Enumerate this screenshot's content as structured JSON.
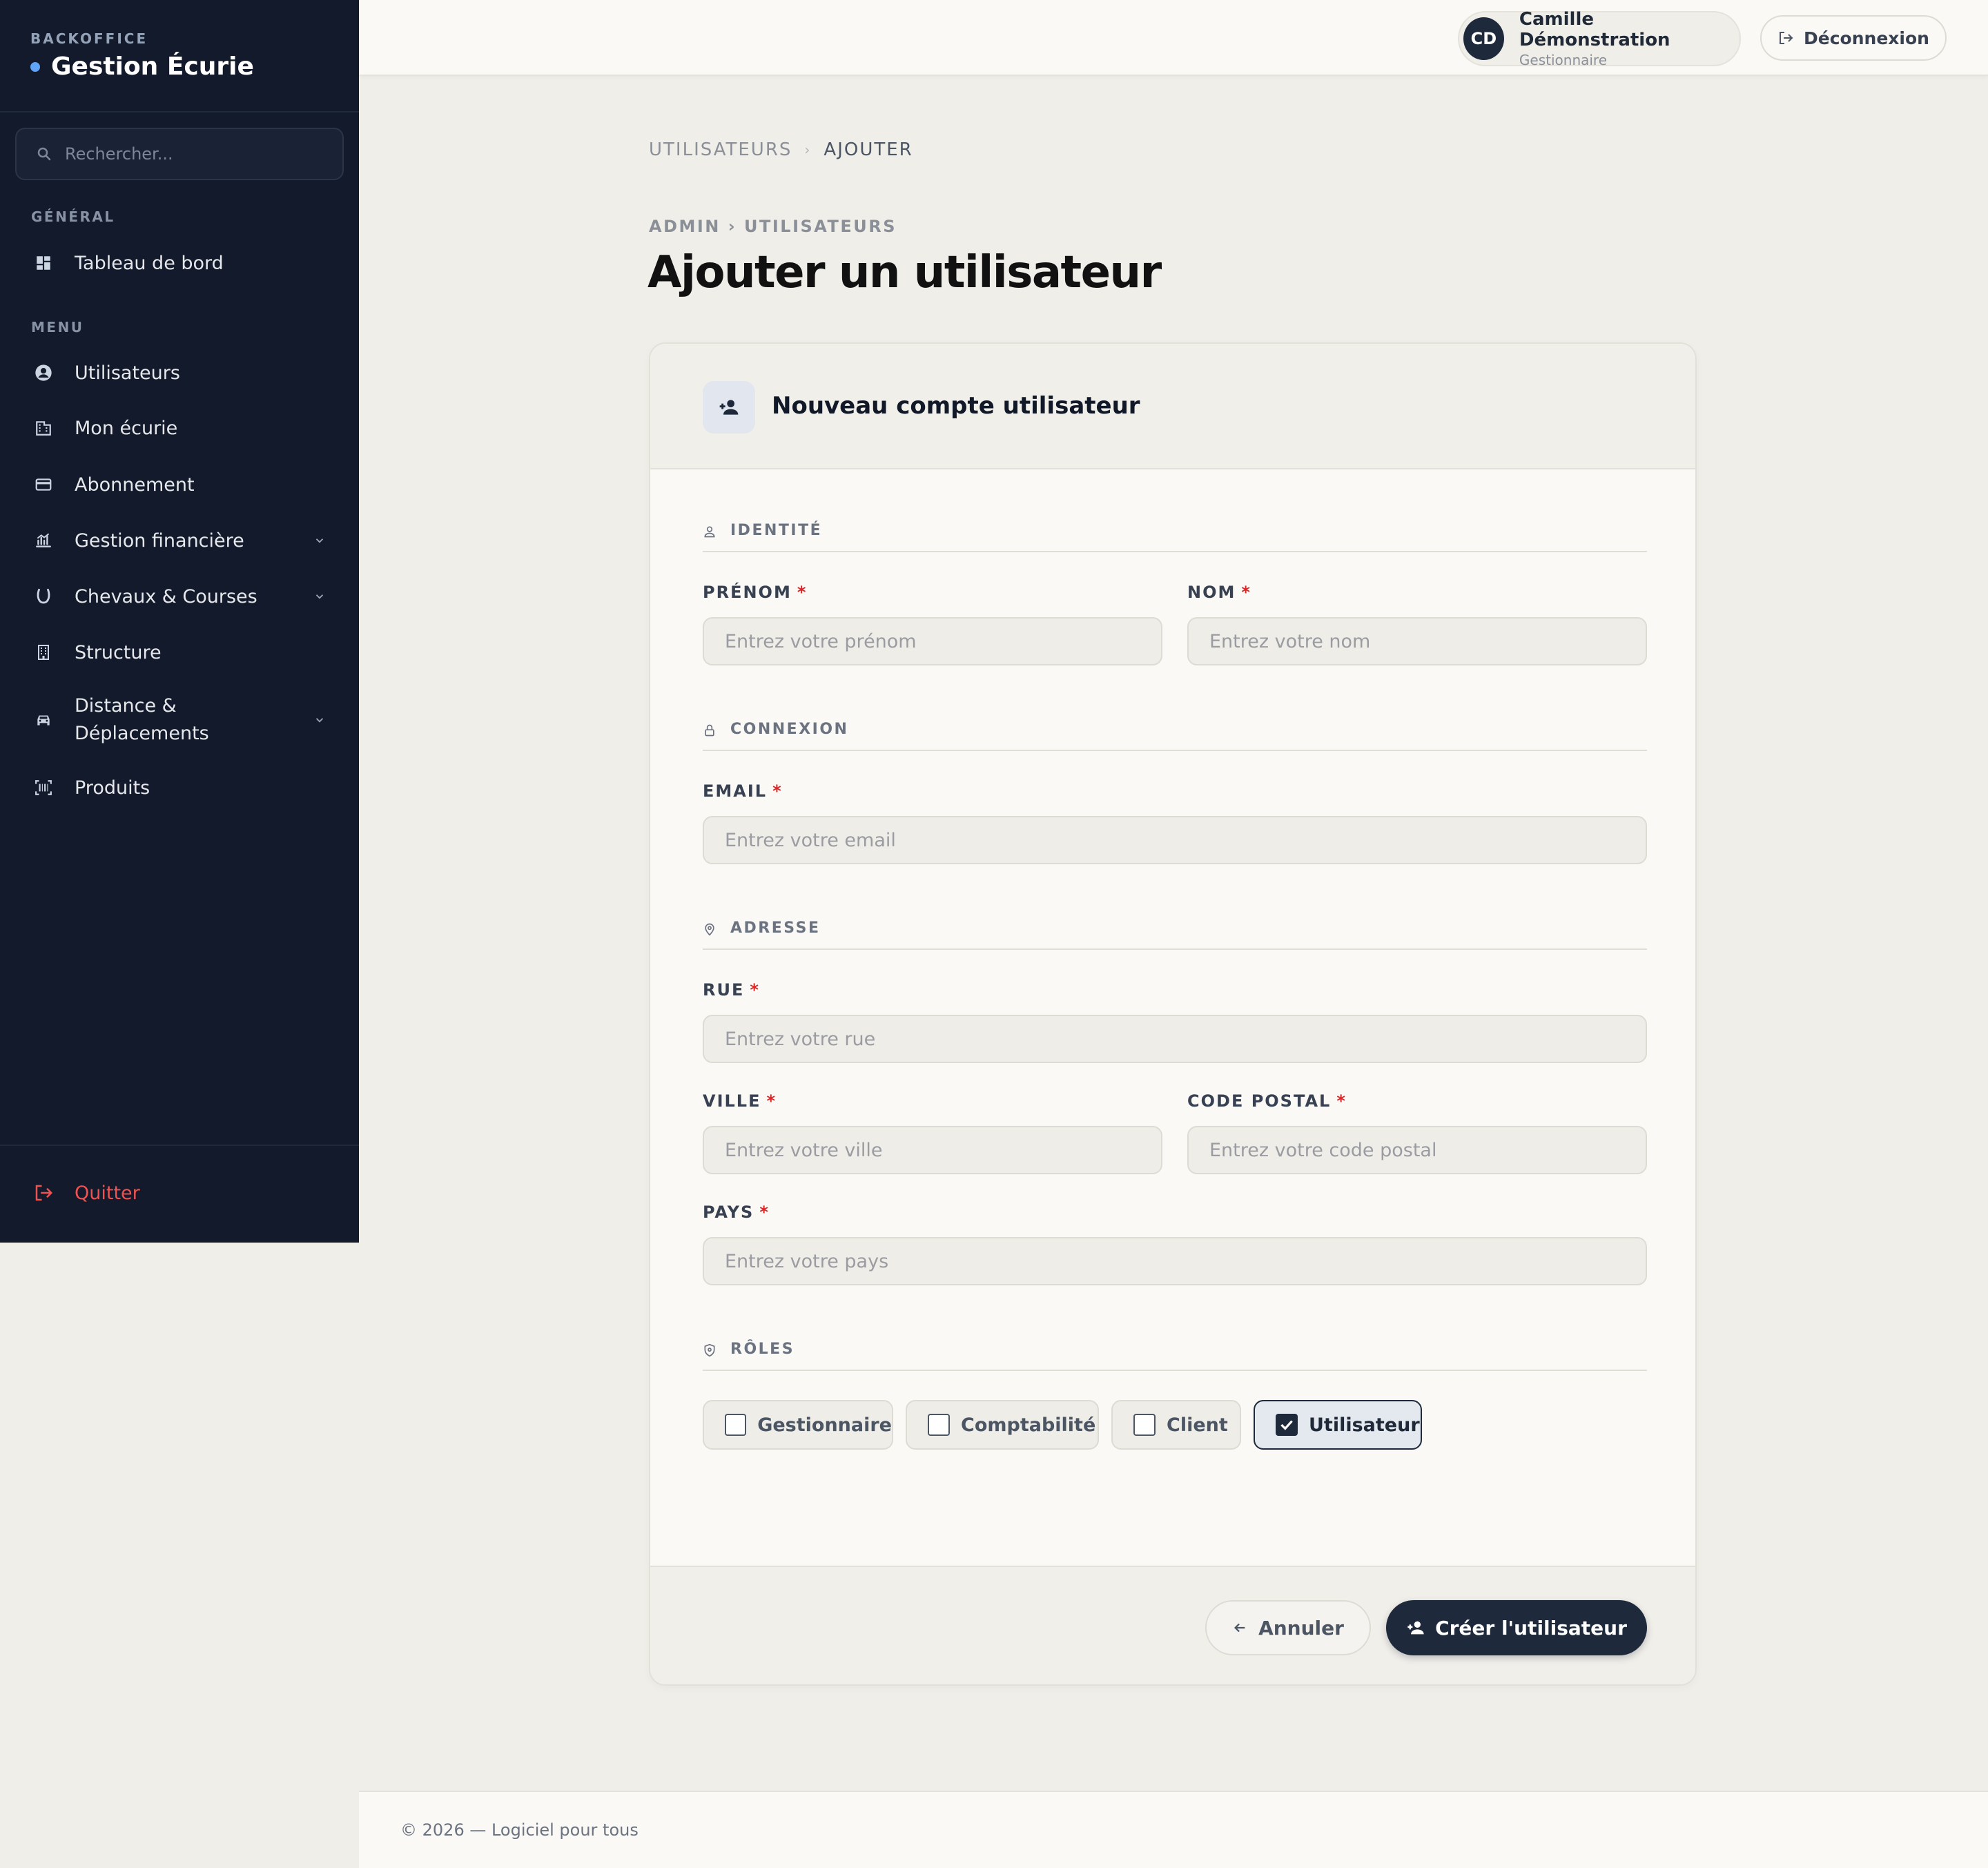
{
  "sidebar": {
    "kicker": "BACKOFFICE",
    "title": "Gestion Écurie",
    "search_placeholder": "Rechercher...",
    "section_general": "GÉNÉRAL",
    "section_menu": "MENU",
    "items": [
      {
        "label": "Tableau de bord",
        "icon": "dashboard-icon"
      },
      {
        "label": "Utilisateurs",
        "icon": "user-circle-icon"
      },
      {
        "label": "Mon écurie",
        "icon": "building-icon"
      },
      {
        "label": "Abonnement",
        "icon": "credit-card-icon"
      },
      {
        "label": "Gestion financière",
        "icon": "finance-icon",
        "expandable": true
      },
      {
        "label": "Chevaux & Courses",
        "icon": "horseshoe-icon",
        "expandable": true
      },
      {
        "label": "Structure",
        "icon": "apartment-icon"
      },
      {
        "label": "Distance & Déplacements",
        "line1": "Distance &",
        "line2": "Déplacements",
        "icon": "car-icon",
        "expandable": true
      },
      {
        "label": "Produits",
        "icon": "barcode-icon"
      }
    ],
    "quit_label": "Quitter"
  },
  "topbar": {
    "user_initials": "CD",
    "user_name": "Camille Démonstration",
    "user_role": "Gestionnaire",
    "logout_label": "Déconnexion"
  },
  "breadcrumb": {
    "parent": "UTILISATEURS",
    "current": "AJOUTER"
  },
  "page": {
    "eyebrow": "ADMIN › UTILISATEURS",
    "title": "Ajouter un utilisateur"
  },
  "form": {
    "title": "Nouveau compte utilisateur",
    "sections": {
      "identity": "IDENTITÉ",
      "connection": "CONNEXION",
      "address": "ADRESSE",
      "roles": "RÔLES"
    },
    "fields": {
      "firstname": {
        "label": "PRÉNOM",
        "placeholder": "Entrez votre prénom",
        "value": ""
      },
      "lastname": {
        "label": "NOM",
        "placeholder": "Entrez votre nom",
        "value": ""
      },
      "email": {
        "label": "EMAIL",
        "placeholder": "Entrez votre email",
        "value": ""
      },
      "street": {
        "label": "RUE",
        "placeholder": "Entrez votre rue",
        "value": ""
      },
      "city": {
        "label": "VILLE",
        "placeholder": "Entrez votre ville",
        "value": ""
      },
      "postal": {
        "label": "CODE POSTAL",
        "placeholder": "Entrez votre code postal",
        "value": ""
      },
      "country": {
        "label": "PAYS",
        "placeholder": "Entrez votre pays",
        "value": ""
      }
    },
    "required_mark": "*",
    "roles": [
      {
        "label": "Gestionnaire",
        "checked": false
      },
      {
        "label": "Comptabilité",
        "checked": false
      },
      {
        "label": "Client",
        "checked": false
      },
      {
        "label": "Utilisateur",
        "checked": true
      }
    ],
    "cancel_label": "Annuler",
    "submit_label": "Créer l'utilisateur"
  },
  "footer": {
    "text": "© 2026 — Logiciel pour tous"
  }
}
